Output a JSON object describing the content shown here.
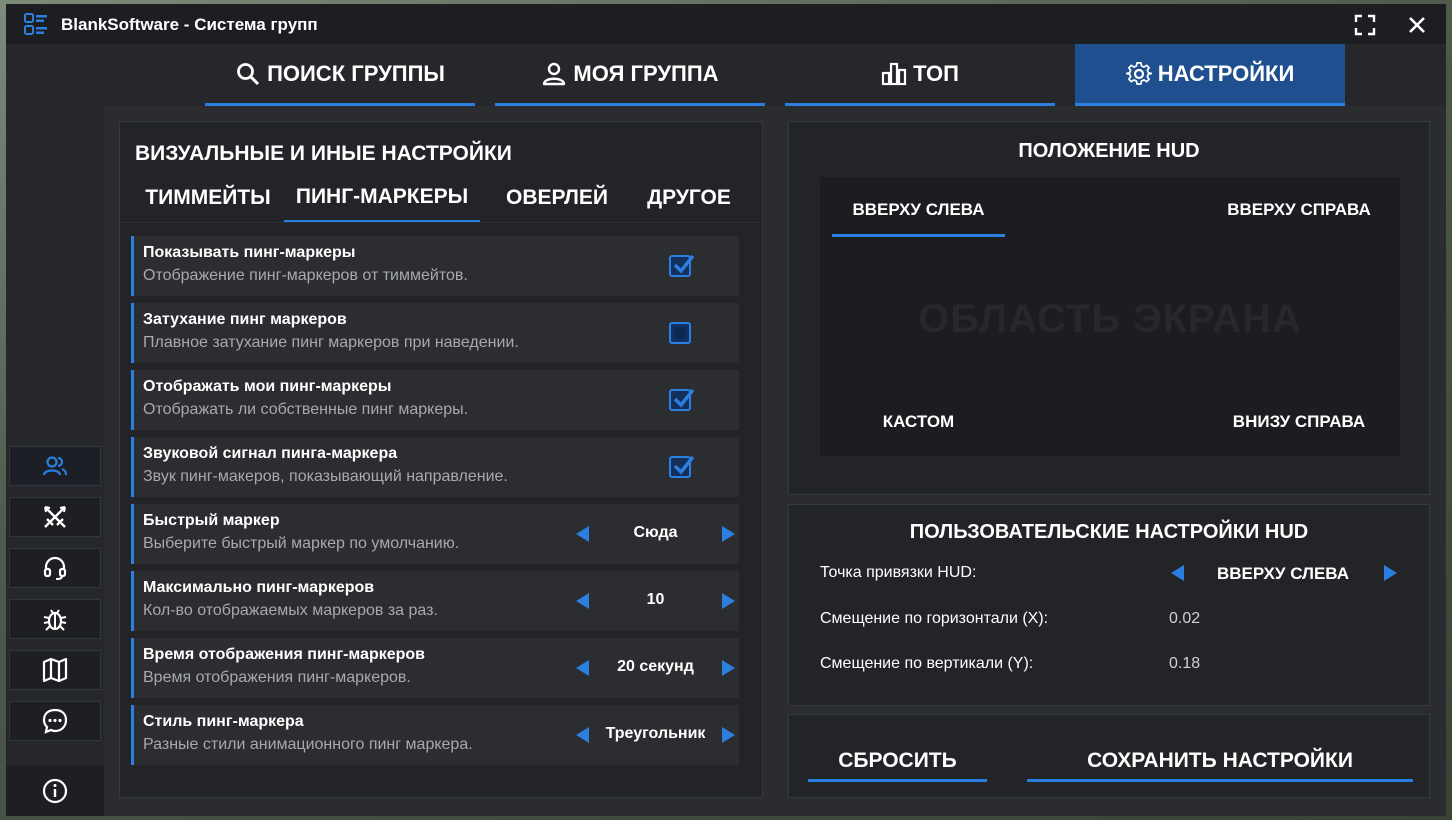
{
  "window": {
    "title": "BlankSoftware - Система групп"
  },
  "top_tabs": [
    {
      "label": "ПОИСК ГРУППЫ",
      "icon": "search-icon"
    },
    {
      "label": "МОЯ ГРУППА",
      "icon": "user-icon"
    },
    {
      "label": "ТОП",
      "icon": "chart-icon"
    },
    {
      "label": "НАСТРОЙКИ",
      "icon": "gear-icon",
      "active": true
    }
  ],
  "sidebar": {
    "items": [
      {
        "icon": "users-icon"
      },
      {
        "icon": "crossed-swords-icon"
      },
      {
        "icon": "headset-icon"
      },
      {
        "icon": "bug-icon"
      },
      {
        "icon": "map-icon"
      },
      {
        "icon": "chat-icon"
      }
    ],
    "footer_icon": "info-icon"
  },
  "settings_panel": {
    "title": "ВИЗУАЛЬНЫЕ И ИНЫЕ НАСТРОЙКИ",
    "tabs": [
      "ТИММЕЙТЫ",
      "ПИНГ-МАРКЕРЫ",
      "ОВЕРЛЕЙ",
      "ДРУГОЕ"
    ],
    "active_tab": "ПИНГ-МАРКЕРЫ",
    "rows": [
      {
        "title": "Показывать пинг-маркеры",
        "desc": "Отображение пинг-маркеров от тиммейтов.",
        "type": "checkbox",
        "checked": true
      },
      {
        "title": "Затухание пинг маркеров",
        "desc": "Плавное затухание пинг маркеров при наведении.",
        "type": "checkbox",
        "checked": false
      },
      {
        "title": "Отображать мои пинг-маркеры",
        "desc": "Отображать ли собственные пинг маркеры.",
        "type": "checkbox",
        "checked": true
      },
      {
        "title": "Звуковой сигнал пинга-маркера",
        "desc": "Звук пинг-макеров, показывающий направление.",
        "type": "checkbox",
        "checked": true
      },
      {
        "title": "Быстрый маркер",
        "desc": "Выберите быстрый маркер по умолчанию.",
        "type": "selector",
        "value": "Сюда"
      },
      {
        "title": "Максимально пинг-маркеров",
        "desc": "Кол-во отображаемых маркеров за раз.",
        "type": "selector",
        "value": "10"
      },
      {
        "title": "Время отображения пинг-маркеров",
        "desc": "Время отображения пинг-маркеров.",
        "type": "selector",
        "value": "20 секунд"
      },
      {
        "title": "Стиль пинг-маркера",
        "desc": "Разные стили анимационного пинг маркера.",
        "type": "selector",
        "value": "Треугольник"
      }
    ]
  },
  "hud_position": {
    "title": "ПОЛОЖЕНИЕ HUD",
    "watermark": "ОБЛАСТЬ ЭКРАНА",
    "top_left": "ВВЕРХУ СЛЕВА",
    "top_right": "ВВЕРХУ СПРАВА",
    "custom": "КАСТОМ",
    "bottom_right": "ВНИЗУ СПРАВА",
    "selected": "ВВЕРХУ СЛЕВА"
  },
  "custom_hud": {
    "title": "ПОЛЬЗОВАТЕЛЬСКИЕ НАСТРОЙКИ HUD",
    "anchor_label": "Точка привязки HUD:",
    "anchor_value": "ВВЕРХУ СЛЕВА",
    "offset_x_label": "Смещение по горизонтали (X):",
    "offset_x_value": "0.02",
    "offset_y_label": "Смещение по вертикали (Y):",
    "offset_y_value": "0.18"
  },
  "buttons": {
    "reset": "СБРОСИТЬ",
    "save": "СОХРАНИТЬ НАСТРОЙКИ"
  },
  "colors": {
    "accent": "#2a7fe0",
    "active_tab_bg": "#1f4f8e",
    "panel_bg": "#222428",
    "row_bg": "#2b2d31"
  }
}
